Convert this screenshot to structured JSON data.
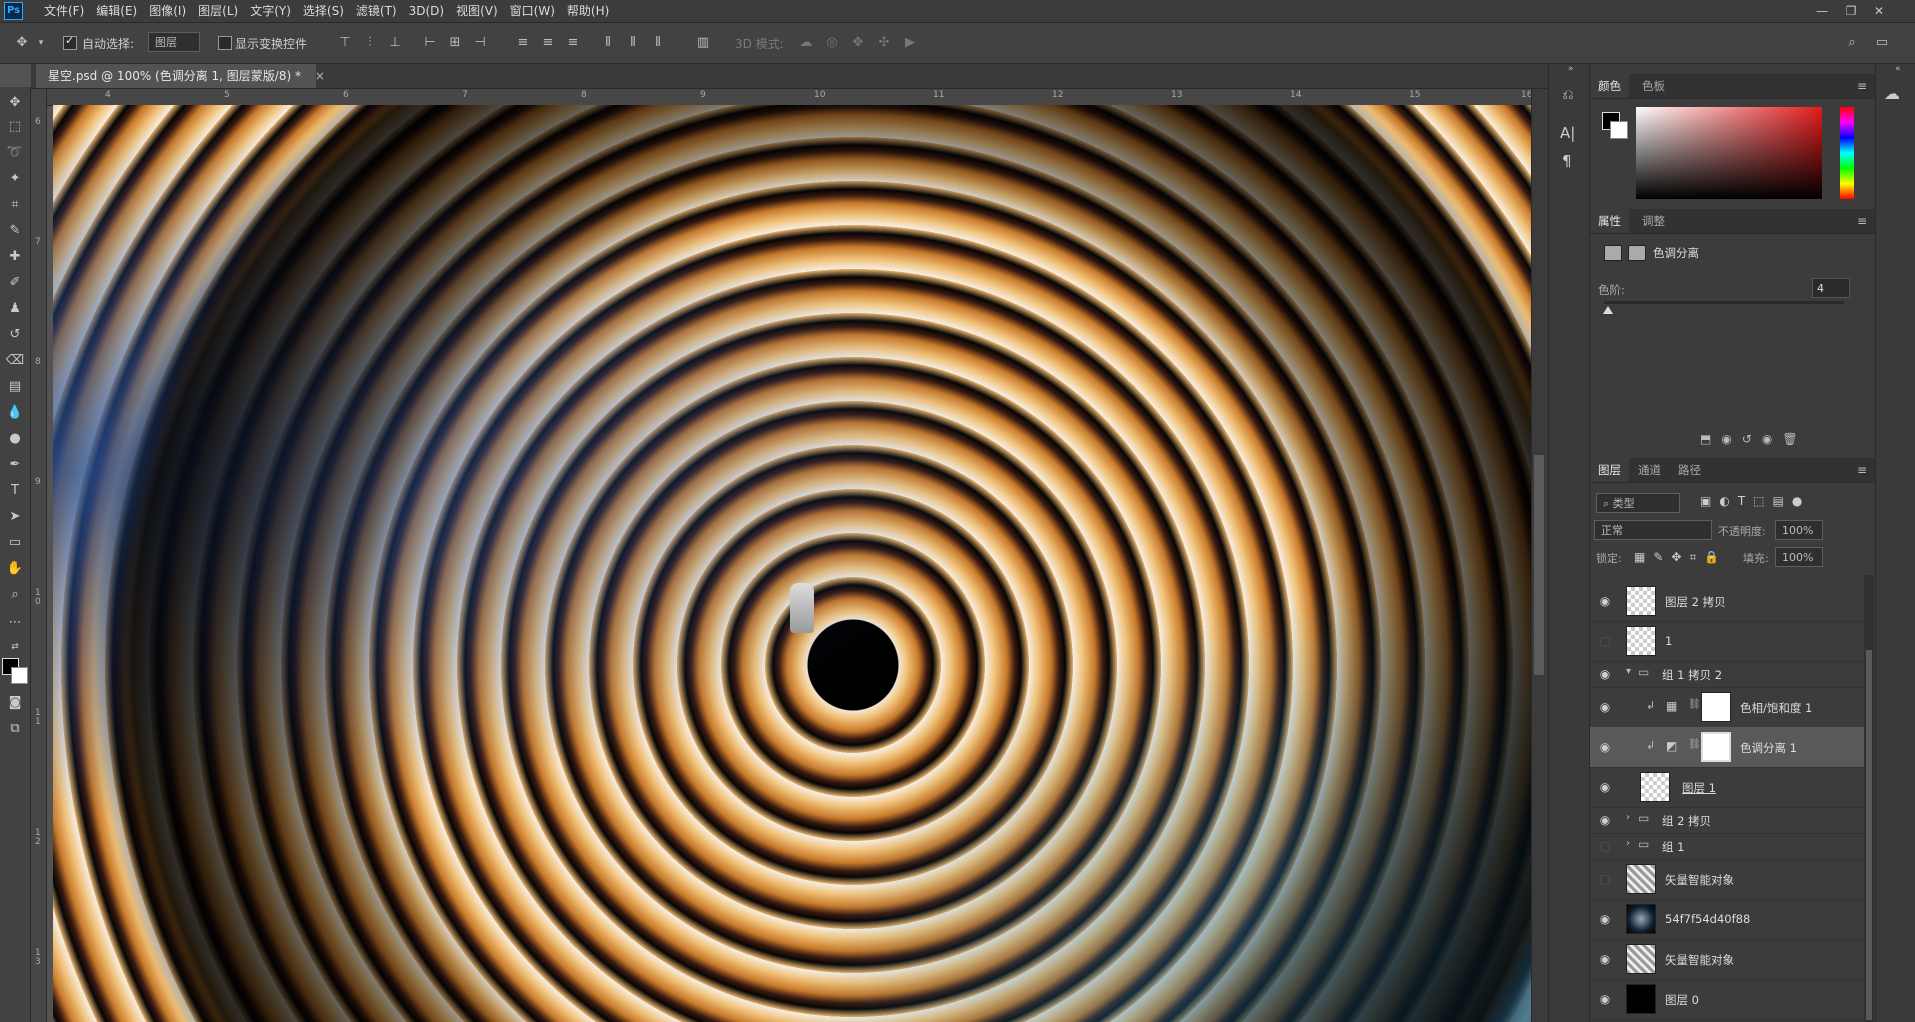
{
  "app": {
    "logo": "Ps"
  },
  "menu": [
    "文件(F)",
    "编辑(E)",
    "图像(I)",
    "图层(L)",
    "文字(Y)",
    "选择(S)",
    "滤镜(T)",
    "3D(D)",
    "视图(V)",
    "窗口(W)",
    "帮助(H)"
  ],
  "options": {
    "auto_select_label": "自动选择:",
    "auto_select_value": "图层",
    "show_transform_label": "显示变换控件",
    "mode_3d_label": "3D 模式:"
  },
  "document": {
    "tab_title": "星空.psd @ 100% (色调分离 1, 图层蒙版/8) *",
    "close_glyph": "×"
  },
  "ruler": {
    "h_labels": [
      "4",
      "5",
      "6",
      "7",
      "8",
      "9",
      "10",
      "11",
      "12",
      "13",
      "14",
      "15",
      "16"
    ],
    "v_labels": [
      "6",
      "7",
      "8",
      "9",
      "1\n0",
      "1\n1",
      "1\n2",
      "1\n3"
    ]
  },
  "color_panel": {
    "tabs": [
      "颜色",
      "色板"
    ],
    "active": "颜色"
  },
  "properties_panel": {
    "tabs": [
      "属性",
      "调整"
    ],
    "active": "属性",
    "title": "色调分离",
    "levels_label": "色阶:",
    "levels_value": "4",
    "levels_fraction": 0.0
  },
  "layers_panel": {
    "tabs": [
      "图层",
      "通道",
      "路径"
    ],
    "active": "图层",
    "filter_kind": "类型",
    "blend_mode": "正常",
    "opacity_label": "不透明度:",
    "opacity_value": "100%",
    "lock_label": "锁定:",
    "fill_label": "填充:",
    "fill_value": "100%",
    "layers": [
      {
        "name": "图层 2 拷贝",
        "visible": true
      },
      {
        "name": "1",
        "visible": false
      },
      {
        "name": "组 1 拷贝 2",
        "visible": true
      },
      {
        "name": "色相/饱和度 1",
        "visible": true
      },
      {
        "name": "色调分离 1",
        "visible": true
      },
      {
        "name": "图层 1",
        "visible": true
      },
      {
        "name": "组 2 拷贝",
        "visible": true
      },
      {
        "name": "组 1",
        "visible": false
      },
      {
        "name": "矢量智能对象",
        "visible": false
      },
      {
        "name": "54f7f54d40f88",
        "visible": true
      },
      {
        "name": "矢量智能对象",
        "visible": true
      },
      {
        "name": "图层 0",
        "visible": true
      }
    ]
  }
}
